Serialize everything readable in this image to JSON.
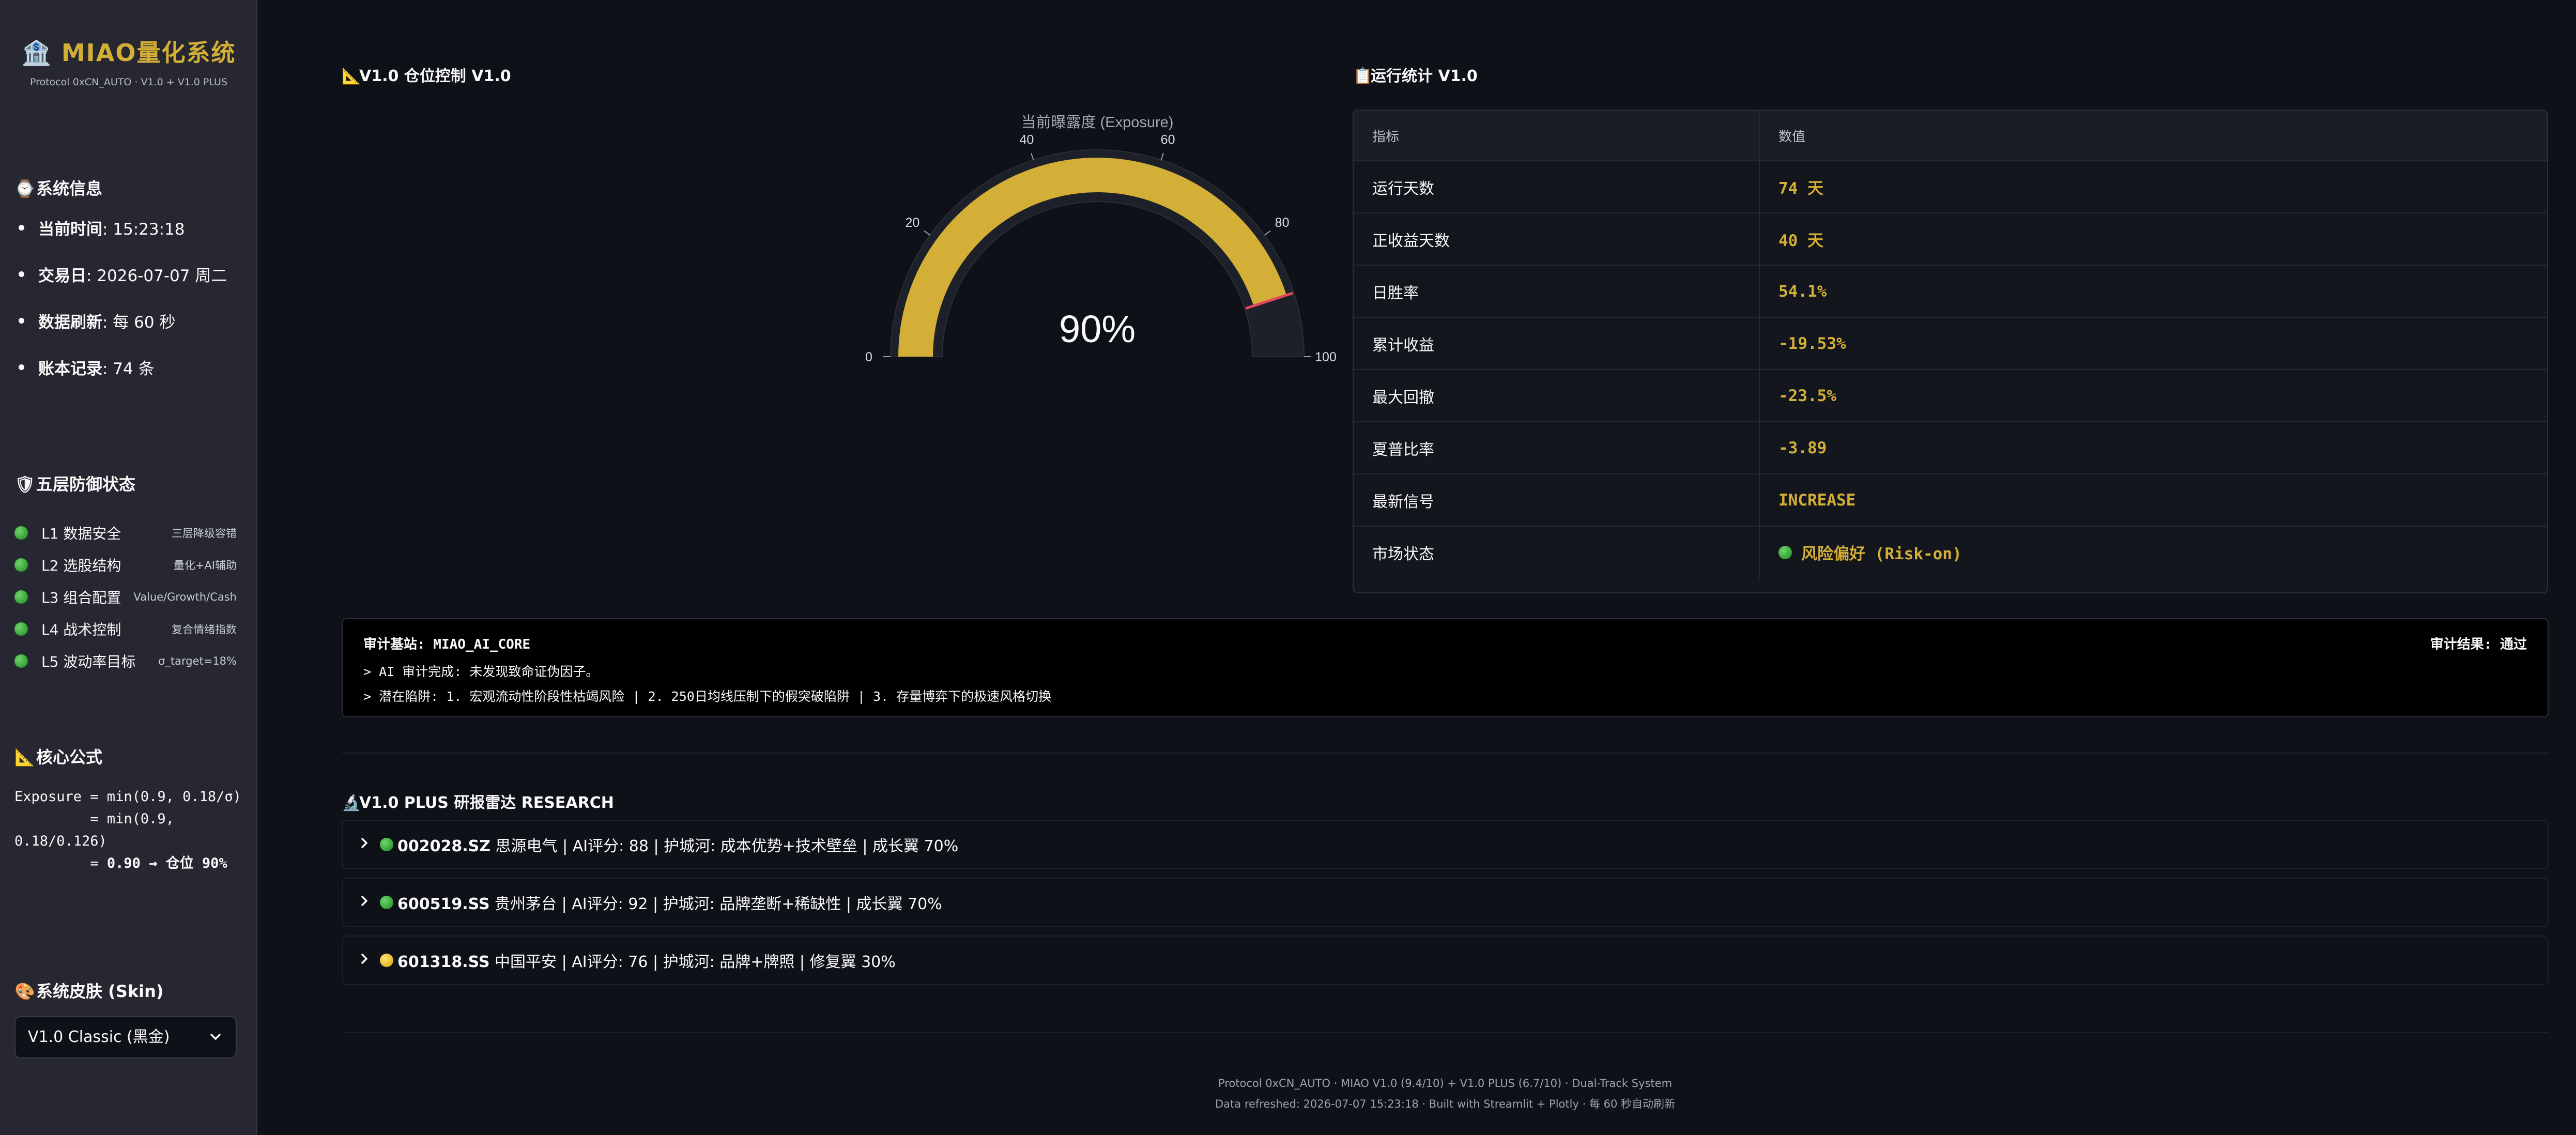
{
  "sidebar": {
    "brand_icon": "🏦",
    "brand_title": "MIAO量化系统",
    "brand_subtitle": "Protocol 0xCN_AUTO · V1.0 + V1.0 PLUS",
    "system_info": {
      "icon": "⌚",
      "title": "系统信息",
      "items": [
        {
          "label": "当前时间",
          "value": ": 15:23:18"
        },
        {
          "label": "交易日",
          "value": ": 2026-07-07 周二"
        },
        {
          "label": "数据刷新",
          "value": ": 每 60 秒"
        },
        {
          "label": "账本记录",
          "value": ": 74 条"
        }
      ]
    },
    "defense": {
      "icon": "🛡",
      "title": "五层防御状态",
      "items": [
        {
          "label": "L1 数据安全",
          "note": "三层降级容错"
        },
        {
          "label": "L2 选股结构",
          "note": "量化+AI辅助"
        },
        {
          "label": "L3 组合配置",
          "note": "Value/Growth/Cash"
        },
        {
          "label": "L4 战术控制",
          "note": "复合情绪指数"
        },
        {
          "label": "L5 波动率目标",
          "note": "σ_target=18%"
        }
      ]
    },
    "formula": {
      "icon": "📐",
      "title": "核心公式",
      "line1": "Exposure = min(0.9, 0.18/σ)",
      "line2": "         = min(0.9, 0.18/0.126)",
      "line3_prefix": "         = ",
      "line3_value": "0.90 → 仓位 90%"
    },
    "skin": {
      "icon": "🎨",
      "title": "系统皮肤 (Skin)",
      "selected": "V1.0 Classic (黑金)"
    }
  },
  "position_control": {
    "icon": "📐",
    "title": "V1.0 仓位控制 V1.0",
    "gauge": {
      "label": "当前曝露度 (Exposure)",
      "value": 90,
      "display": "90%",
      "min": 0,
      "max": 100,
      "ticks": [
        "0",
        "20",
        "40",
        "60",
        "80",
        "100"
      ],
      "threshold": 90,
      "bar_color": "#d4af37",
      "threshold_color": "#e2475e"
    }
  },
  "run_stats": {
    "icon": "📋",
    "title": "运行统计 V1.0",
    "header": {
      "metric": "指标",
      "value": "数值"
    },
    "rows": [
      {
        "metric": "运行天数",
        "value": "74 天"
      },
      {
        "metric": "正收益天数",
        "value": "40 天"
      },
      {
        "metric": "日胜率",
        "value": "54.1%"
      },
      {
        "metric": "累计收益",
        "value": "-19.53%"
      },
      {
        "metric": "最大回撤",
        "value": "-23.5%"
      },
      {
        "metric": "夏普比率",
        "value": "-3.89"
      },
      {
        "metric": "最新信号",
        "value": "INCREASE"
      },
      {
        "metric": "市场状态",
        "value": "风险偏好 (Risk-on)"
      }
    ]
  },
  "audit": {
    "header": "审计基站: MIAO_AI_CORE",
    "result": "审计结果: 通过",
    "line1": "> AI 审计完成: 未发现致命证伪因子。",
    "line2": "> 潜在陷阱: 1. 宏观流动性阶段性枯竭风险 | 2. 250日均线压制下的假突破陷阱 | 3. 存量博弈下的极速风格切换"
  },
  "research": {
    "icon": "🔬",
    "title": "V1.0 PLUS 研报雷达 RESEARCH",
    "items": [
      {
        "status": "green",
        "code": "002028.SZ",
        "rest": " 思源电气 | AI评分: 88 | 护城河: 成本优势+技术壁垒 | 成长翼 70%"
      },
      {
        "status": "green",
        "code": "600519.SS",
        "rest": " 贵州茅台 | AI评分: 92 | 护城河: 品牌垄断+稀缺性 | 成长翼 70%"
      },
      {
        "status": "yellow",
        "code": "601318.SS",
        "rest": " 中国平安 | AI评分: 76 | 护城河: 品牌+牌照 | 修复翼 30%"
      }
    ]
  },
  "footer": {
    "line1": "Protocol 0xCN_AUTO · MIAO V1.0 (9.4/10) + V1.0 PLUS (6.7/10) · Dual-Track System",
    "line2": "Data refreshed: 2026-07-07 15:23:18 · Built with Streamlit + Plotly · 每 60 秒自动刷新"
  }
}
